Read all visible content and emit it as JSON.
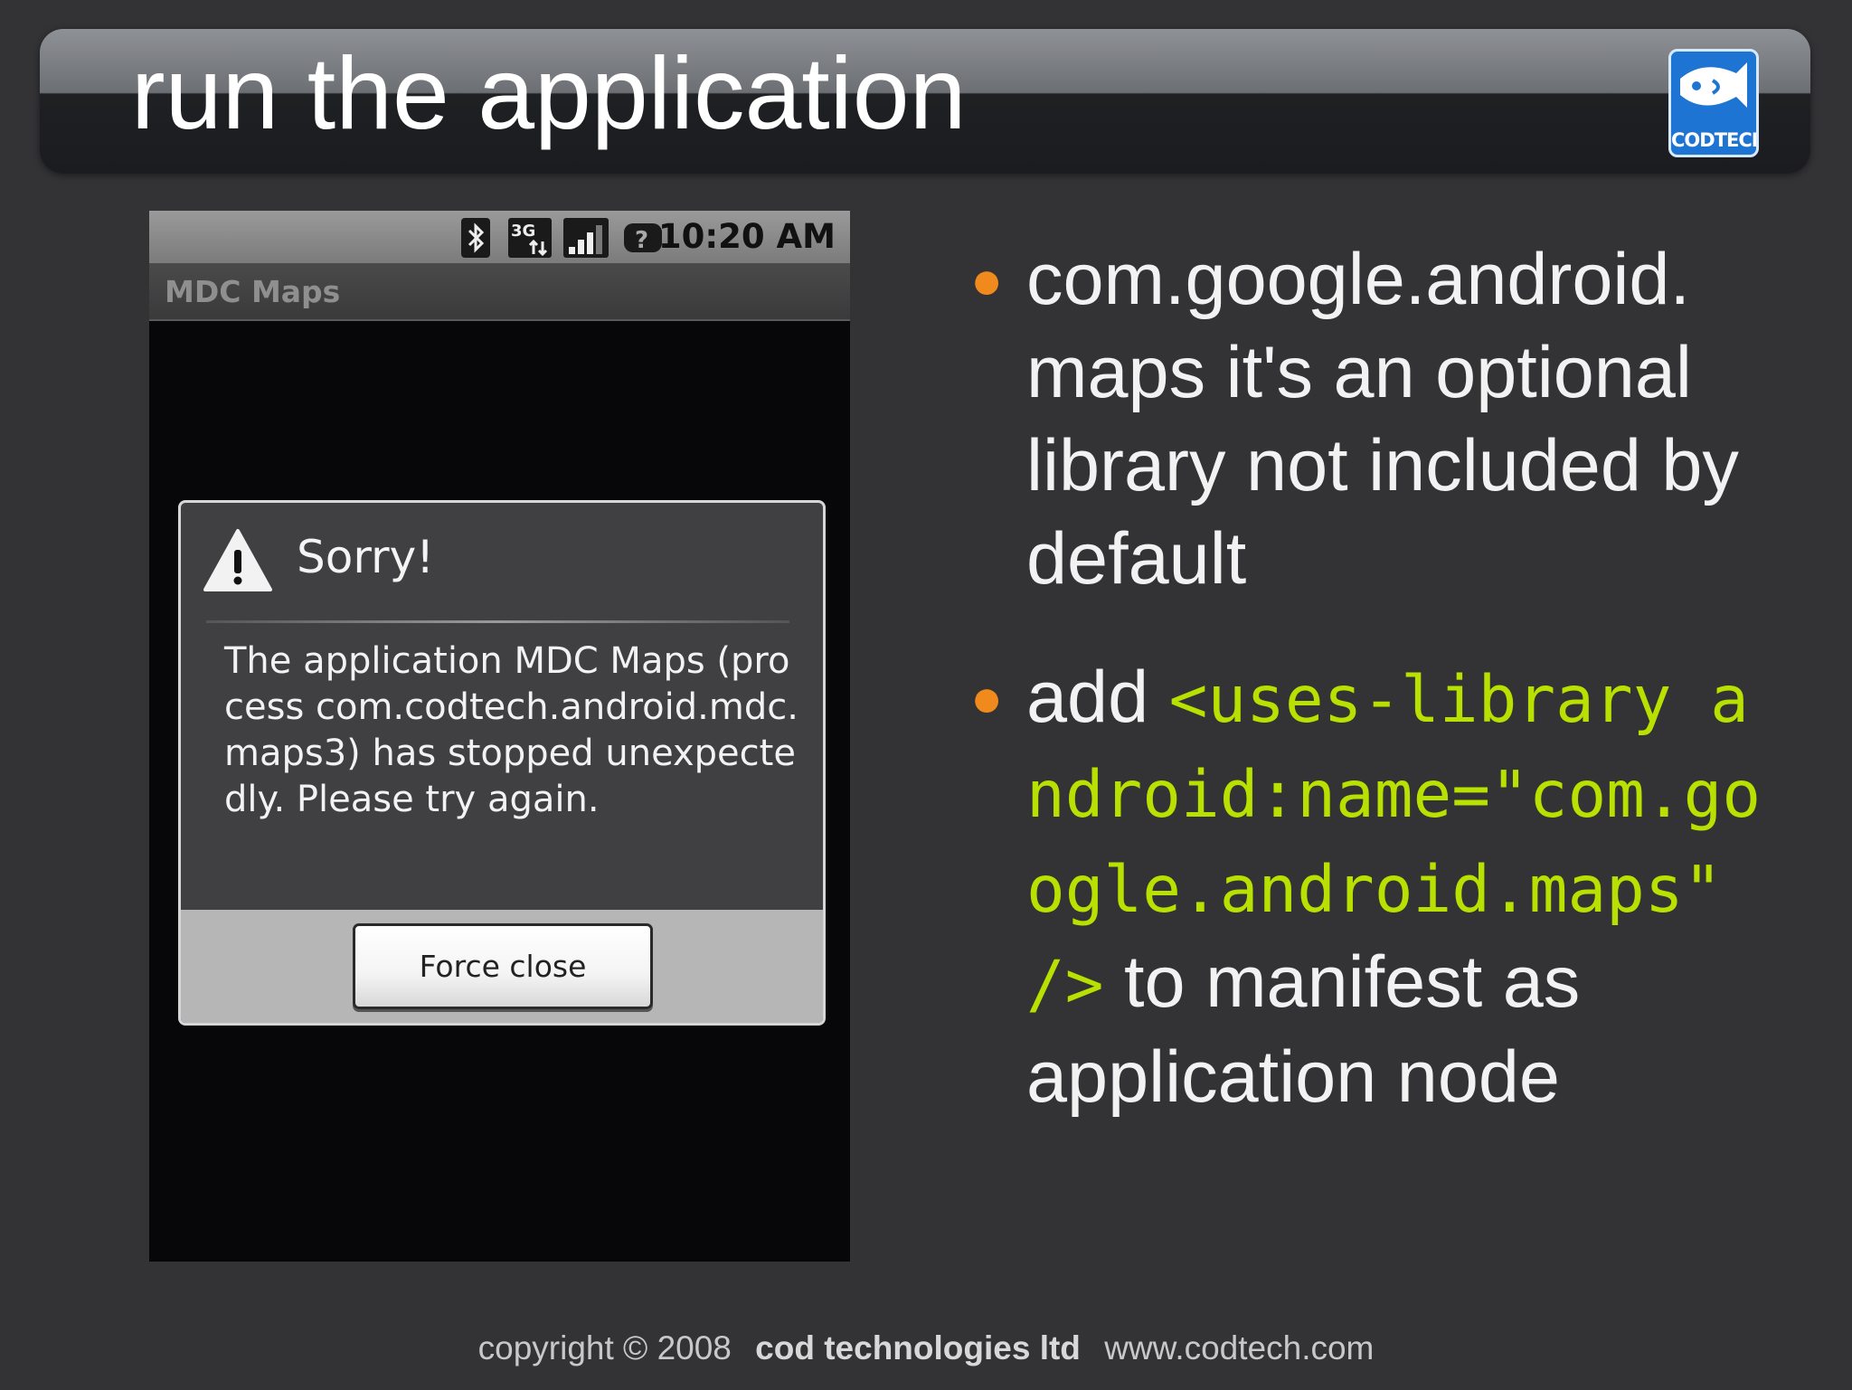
{
  "slide": {
    "title": "run the application",
    "logo_text": "CODTECH"
  },
  "phone": {
    "status_bar": {
      "time": "10:20 AM",
      "icons": [
        "bluetooth-icon",
        "3g-icon",
        "signal-icon",
        "battery-unknown-icon"
      ]
    },
    "app_title": "MDC Maps",
    "dialog": {
      "title": "Sorry!",
      "message": "The application MDC Maps (process com.codtech.android.mdc.maps3) has stopped unexpectedly. Please try again.",
      "button_label": "Force close"
    }
  },
  "bullets": {
    "item1": "com.google.android. maps it's an optional library not included by default",
    "item2_prefix": "add",
    "item2_code": "<uses-library android:name=\"com.google.android.maps\" />",
    "item2_suffix": "to manifest as application node"
  },
  "footer": {
    "copyright": "copyright © 2008",
    "company": "cod technologies ltd",
    "website": "www.codtech.com"
  },
  "colors": {
    "background": "#333335",
    "bullet_accent": "#f08a1c",
    "code_text": "#b8e000"
  }
}
